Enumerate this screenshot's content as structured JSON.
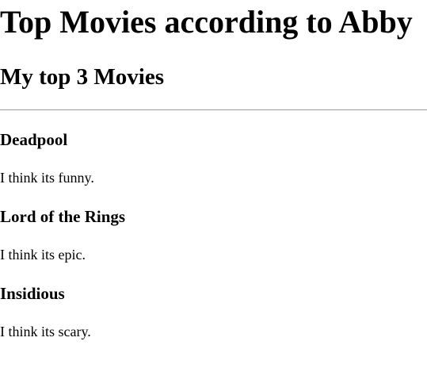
{
  "page": {
    "title": "Top Movies according to Abby",
    "subtitle": "My top 3 Movies"
  },
  "movies": [
    {
      "title": "Deadpool",
      "description": "I think its funny."
    },
    {
      "title": "Lord of the Rings",
      "description": "I think its epic."
    },
    {
      "title": "Insidious",
      "description": "I think its scary."
    }
  ]
}
